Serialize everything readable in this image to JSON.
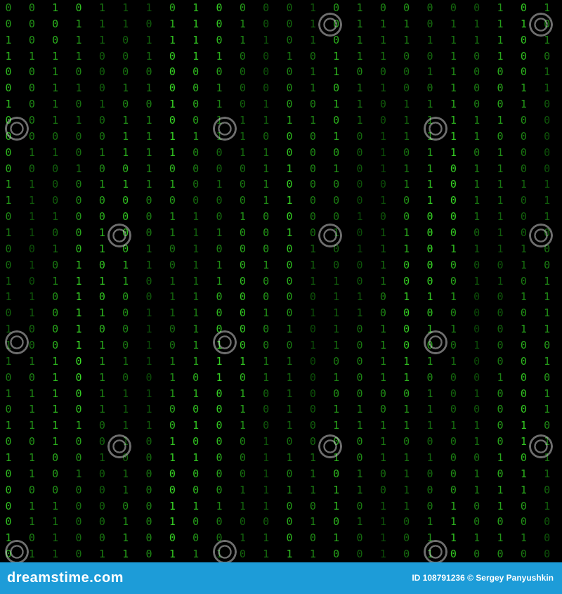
{
  "image": {
    "description_colors": {
      "background": "#000000",
      "digit_bright": "#39d63a",
      "digit_mid": "#1e8a22",
      "digit_dim": "#0f4a13",
      "footer": "#1d9cd8"
    }
  },
  "watermark": {
    "text": "dreamstime"
  },
  "footer": {
    "logo": "dreamstime.com",
    "id_label": "ID 108791236",
    "separator": "©",
    "author": "Sergey Panyushkin"
  }
}
